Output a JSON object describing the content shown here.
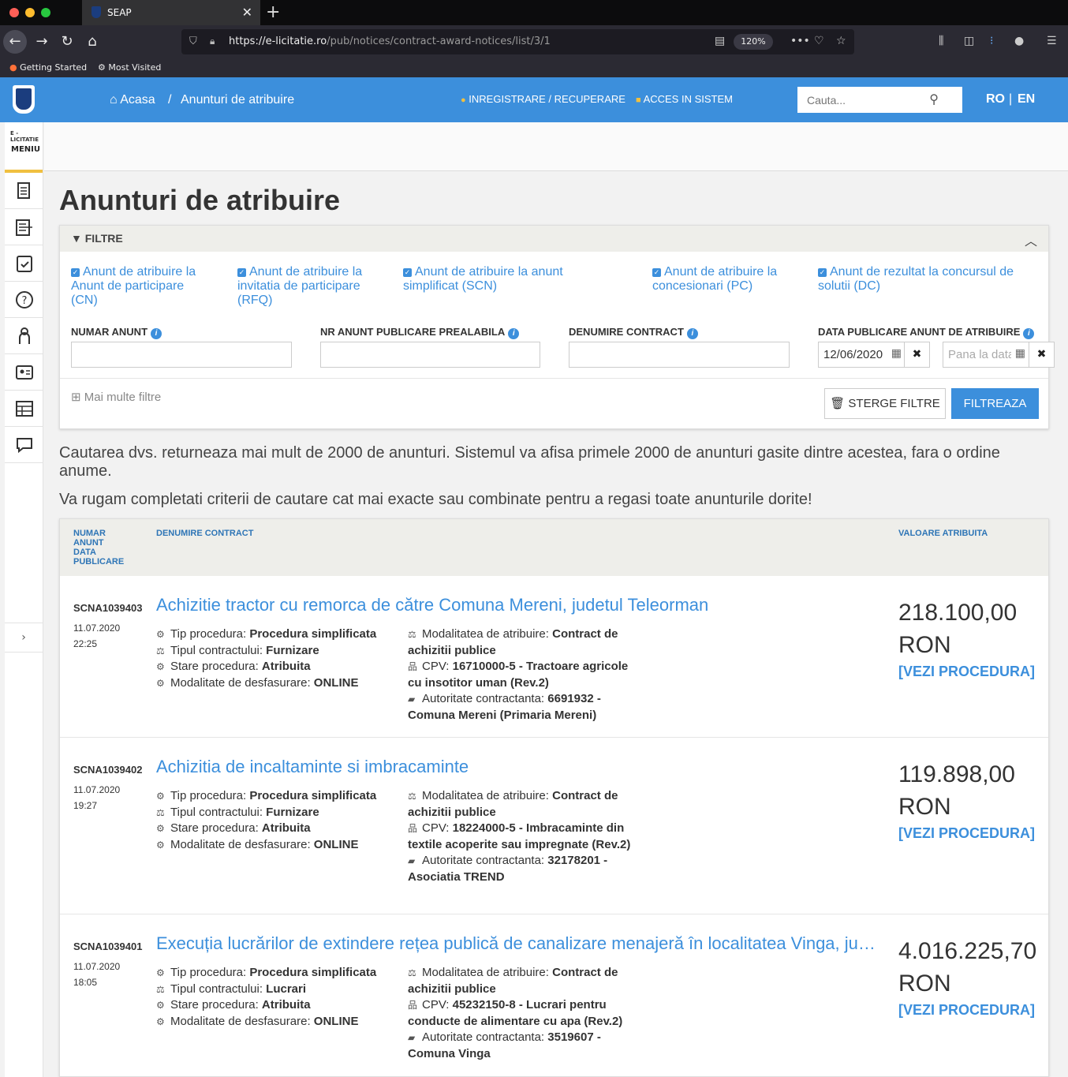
{
  "browser": {
    "tab_title": "SEAP",
    "url_host": "https://e-licitatie.ro",
    "url_path": "/pub/notices/contract-award-notices/list/3/1",
    "zoom": "120%",
    "bookmarks": [
      "Getting Started",
      "Most Visited"
    ]
  },
  "header": {
    "breadcrumb_home": "Acasa",
    "breadcrumb_sep": "/",
    "breadcrumb_current": "Anunturi de atribuire",
    "register_link": "INREGISTRARE / RECUPERARE",
    "login_link": "ACCES IN SISTEM",
    "search_placeholder": "Cauta...",
    "lang_ro": "RO",
    "lang_sep": "|",
    "lang_en": "EN"
  },
  "sidebar": {
    "brand": "E - LICITATIE",
    "menu_label": "MENIU",
    "expand_glyph": "›",
    "items": [
      "document-icon",
      "list-export-icon",
      "clipboard-check-icon",
      "help-icon",
      "user-icon",
      "id-card-icon",
      "table-icon",
      "chat-icon"
    ]
  },
  "page": {
    "title": "Anunturi de atribuire"
  },
  "filters": {
    "header": "FILTRE",
    "checkboxes": [
      "Anunt de atribuire la Anunt de participare (CN)",
      "Anunt de atribuire la invitatia de participare (RFQ)",
      "Anunt de atribuire la anunt simplificat (SCN)",
      "Anunt de atribuire la concesionari (PC)",
      "Anunt de rezultat la concursul de solutii (DC)"
    ],
    "fields": {
      "numar_anunt": "NUMAR ANUNT",
      "nr_prealabila": "NR ANUNT PUBLICARE PREALABILA",
      "denumire_contract": "DENUMIRE CONTRACT",
      "data_publicare": "DATA PUBLICARE ANUNT DE ATRIBUIRE"
    },
    "date_from": "12/06/2020",
    "date_to_placeholder": "Pana la data",
    "more_filters": "Mai multe filtre",
    "clear_button": "STERGE FILTRE",
    "filter_button": "FILTREAZA"
  },
  "messages": {
    "line1": "Cautarea dvs. returneaza mai mult de 2000 de anunturi. Sistemul va afisa primele 2000 de anunturi gasite dintre acestea, fara o ordine anume.",
    "line2": "Va rugam completati criterii de cautare cat mai exacte sau combinate pentru a regasi toate anunturile dorite!"
  },
  "table": {
    "col_numar": "NUMAR ANUNT DATA PUBLICARE",
    "col_denumire": "DENUMIRE CONTRACT",
    "col_valoare": "VALOARE ATRIBUITA",
    "labels": {
      "tip_procedura": "Tip procedura:",
      "tip_contract": "Tipul contractului:",
      "stare": "Stare procedura:",
      "modalitate_desf": "Modalitate de desfasurare:",
      "modalitate_atrib": "Modalitatea de atribuire:",
      "cpv": "CPV:",
      "autoritate": "Autoritate contractanta:"
    },
    "view_link": "[VEZI PROCEDURA]",
    "rows": [
      {
        "numar": "SCNA1039403",
        "date": "11.07.2020",
        "time": "22:25",
        "title": "Achizitie tractor cu remorca de către Comuna Mereni, judetul Teleorman",
        "tip_procedura": "Procedura simplificata",
        "tip_contract": "Furnizare",
        "stare": "Atribuita",
        "modalitate_desf": "ONLINE",
        "modalitate_atrib": "Contract de achizitii publice",
        "cpv": "16710000-5 - Tractoare agricole cu insotitor uman (Rev.2)",
        "autoritate": "6691932 - Comuna Mereni (Primaria Mereni)",
        "valoare": "218.100,00",
        "moneda": "RON"
      },
      {
        "numar": "SCNA1039402",
        "date": "11.07.2020",
        "time": "19:27",
        "title": "Achizitia de incaltaminte si imbracaminte",
        "tip_procedura": "Procedura simplificata",
        "tip_contract": "Furnizare",
        "stare": "Atribuita",
        "modalitate_desf": "ONLINE",
        "modalitate_atrib": "Contract de achizitii publice",
        "cpv": "18224000-5 - Imbracaminte din textile acoperite sau impregnate (Rev.2)",
        "autoritate": "32178201 - Asociatia TREND",
        "valoare": "119.898,00",
        "moneda": "RON"
      },
      {
        "numar": "SCNA1039401",
        "date": "11.07.2020",
        "time": "18:05",
        "title": "Execuția lucrărilor de extindere rețea publică de canalizare menajeră în localitatea Vinga, judetul Arad",
        "tip_procedura": "Procedura simplificata",
        "tip_contract": "Lucrari",
        "stare": "Atribuita",
        "modalitate_desf": "ONLINE",
        "modalitate_atrib": "Contract de achizitii publice",
        "cpv": "45232150-8 - Lucrari pentru conducte de alimentare cu apa (Rev.2)",
        "autoritate": "3519607 - Comuna Vinga",
        "valoare": "4.016.225,70",
        "moneda": "RON"
      }
    ]
  }
}
